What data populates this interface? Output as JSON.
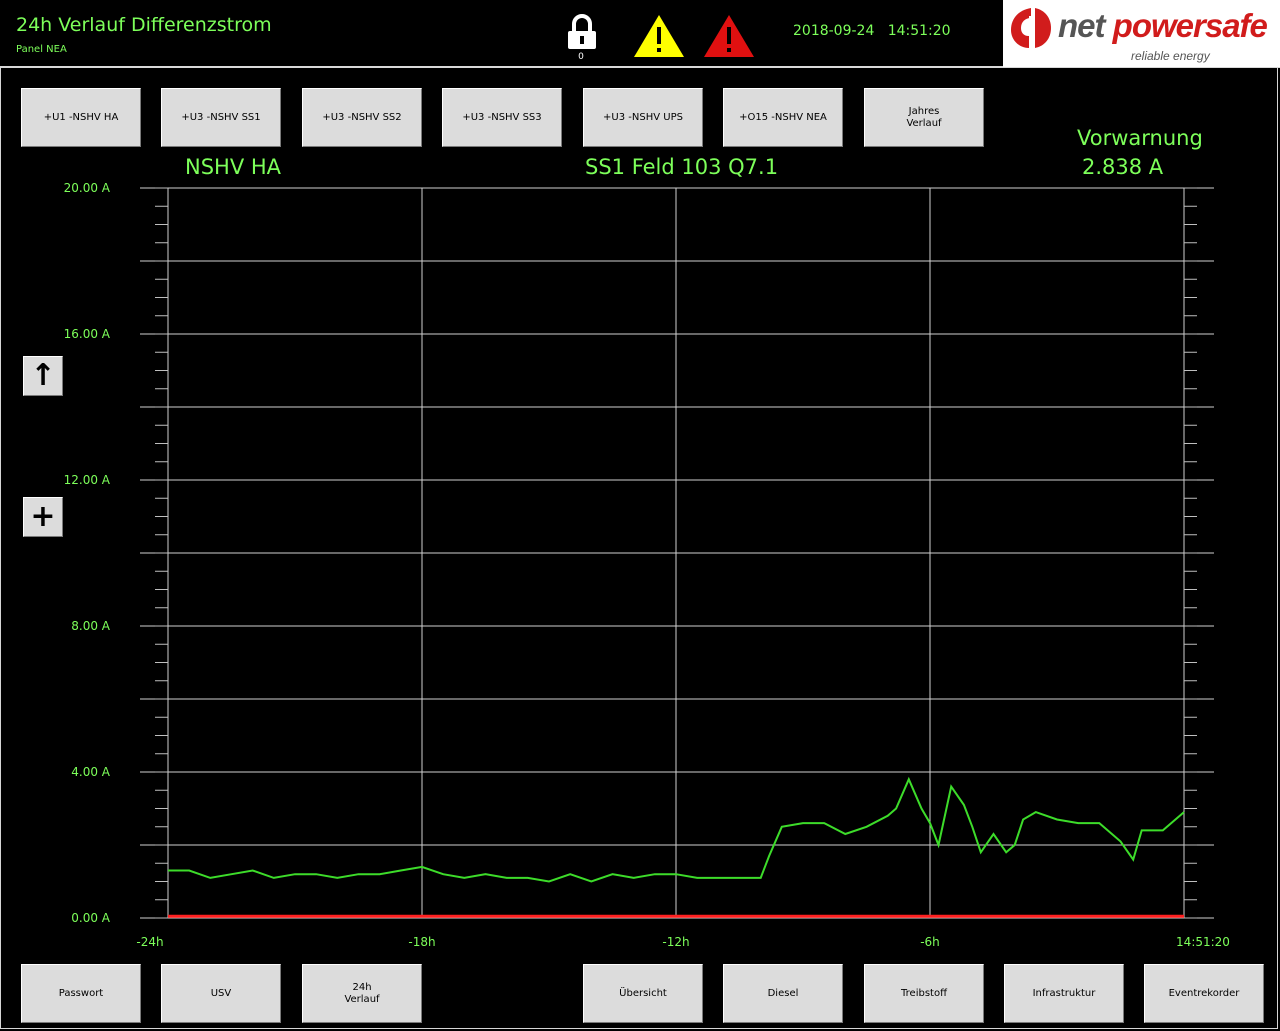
{
  "header": {
    "title": "24h Verlauf Differenzstrom",
    "subtitle": "Panel NEA",
    "lock_count": "0",
    "datetime": "2018-09-24   14:51:20",
    "logo": {
      "word1": "net",
      "word2": "powersafe",
      "tagline": "reliable energy"
    },
    "colors": {
      "accent": "#7dff5a",
      "warning_yellow": "#ffff00",
      "alarm_red": "#e01010",
      "button": "#dcdcdc"
    }
  },
  "top_buttons": [
    {
      "label": "+U1 -NSHV HA"
    },
    {
      "label": "+U3 -NSHV SS1"
    },
    {
      "label": "+U3 -NSHV SS2"
    },
    {
      "label": "+U3 -NSHV SS3"
    },
    {
      "label": "+U3 -NSHV UPS"
    },
    {
      "label": "+O15 -NSHV NEA"
    },
    {
      "label": "Jahres\nVerlauf"
    }
  ],
  "labels": {
    "location": "NSHV HA",
    "feeder": "SS1 Feld 103 Q7.1",
    "prewarning_title": "Vorwarnung",
    "prewarning_value": "2.838 A"
  },
  "side_buttons": {
    "up_icon": "arrow-up-icon",
    "plus_icon": "plus-icon",
    "up_glyph": "↑",
    "plus_glyph": "+"
  },
  "chart_data": {
    "type": "line",
    "title": "",
    "xlabel": "",
    "ylabel": "",
    "x_ticks": [
      "-24h",
      "-18h",
      "-12h",
      "-6h",
      "14:51:20"
    ],
    "y_ticks": [
      "0.00 A",
      "4.00 A",
      "8.00 A",
      "12.00 A",
      "16.00 A",
      "20.00 A"
    ],
    "xlim": [
      -24,
      0
    ],
    "ylim": [
      0,
      20
    ],
    "grid": true,
    "series": [
      {
        "color": "#3ddc2a",
        "x": [
          -24,
          -23.5,
          -23,
          -22.5,
          -22,
          -21.5,
          -21,
          -20.5,
          -20,
          -19.5,
          -19,
          -18.5,
          -18,
          -17.5,
          -17,
          -16.5,
          -16,
          -15.5,
          -15,
          -14.5,
          -14,
          -13.5,
          -13,
          -12.5,
          -12,
          -11.5,
          -11,
          -10.5,
          -10,
          -9.8,
          -9.5,
          -9,
          -8.5,
          -8,
          -7.5,
          -7,
          -6.8,
          -6.5,
          -6.2,
          -6,
          -5.8,
          -5.5,
          -5.2,
          -5,
          -4.8,
          -4.5,
          -4.2,
          -4,
          -3.8,
          -3.5,
          -3,
          -2.5,
          -2,
          -1.5,
          -1.2,
          -1,
          -0.5,
          0
        ],
        "values": [
          1.3,
          1.3,
          1.1,
          1.2,
          1.3,
          1.1,
          1.2,
          1.2,
          1.1,
          1.2,
          1.2,
          1.3,
          1.4,
          1.2,
          1.1,
          1.2,
          1.1,
          1.1,
          1.0,
          1.2,
          1.0,
          1.2,
          1.1,
          1.2,
          1.2,
          1.1,
          1.1,
          1.1,
          1.1,
          1.7,
          2.5,
          2.6,
          2.6,
          2.3,
          2.5,
          2.8,
          3.0,
          3.8,
          3.0,
          2.6,
          2.0,
          3.6,
          3.1,
          2.5,
          1.8,
          2.3,
          1.8,
          2.0,
          2.7,
          2.9,
          2.7,
          2.6,
          2.6,
          2.1,
          1.6,
          2.4,
          2.4,
          2.9
        ]
      },
      {
        "color": "#ff2020",
        "x": [
          -24,
          0
        ],
        "values": [
          0.05,
          0.05
        ]
      }
    ]
  },
  "bottom_buttons": [
    {
      "label": "Passwort"
    },
    {
      "label": "USV"
    },
    {
      "label": "24h\nVerlauf"
    },
    {
      "label": "Übersicht"
    },
    {
      "label": "Diesel"
    },
    {
      "label": "Treibstoff"
    },
    {
      "label": "Infrastruktur"
    },
    {
      "label": "Eventrekorder"
    }
  ]
}
